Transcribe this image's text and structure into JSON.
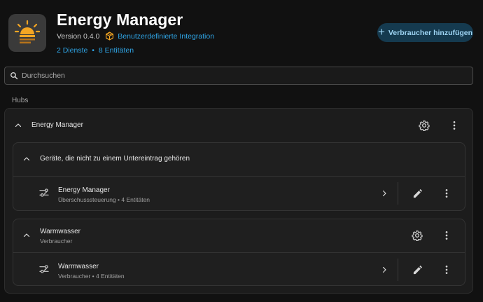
{
  "header": {
    "title": "Energy Manager",
    "version": "Version 0.4.0",
    "custom_integration": "Benutzerdefinierte Integration",
    "services_link": "2 Dienste",
    "separator": "•",
    "entities_link": "8 Entitäten",
    "add_button": "Verbraucher hinzufügen",
    "logo_icon": "solar-panel-icon",
    "accent_color": "#2fa5e6"
  },
  "search": {
    "placeholder": "Durchsuchen"
  },
  "section": {
    "label": "Hubs"
  },
  "hub": {
    "title": "Energy Manager",
    "groups": [
      {
        "title": "Geräte, die nicht zu einem Untereintrag gehören",
        "subtitle": "",
        "entries": [
          {
            "name": "Energy Manager",
            "desc": "Überschusssteuerung • 4 Entitäten"
          }
        ]
      },
      {
        "title": "Warmwasser",
        "subtitle": "Verbraucher",
        "entries": [
          {
            "name": "Warmwasser",
            "desc": "Verbraucher • 4 Entitäten"
          }
        ]
      }
    ]
  }
}
